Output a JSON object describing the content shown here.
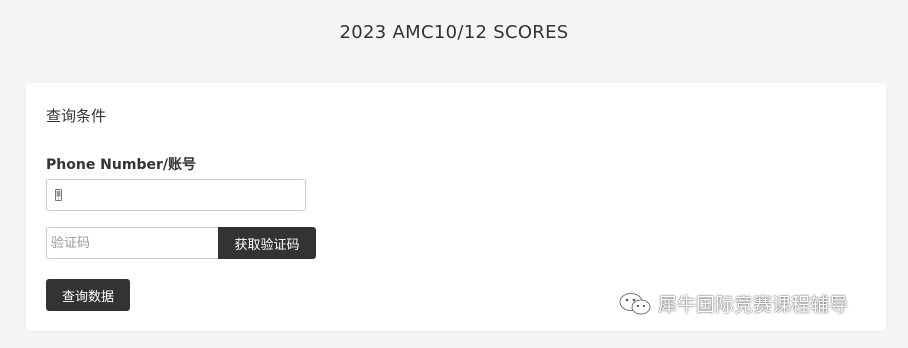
{
  "header": {
    "title": "2023 AMC10/12 SCORES"
  },
  "form": {
    "title": "查询条件",
    "phone_label": "Phone Number/账号",
    "phone_value": "",
    "code_placeholder": "验证码",
    "code_value": "",
    "get_code_label": "获取验证码",
    "submit_label": "查询数据"
  },
  "watermark": {
    "text": "犀牛国际竞赛课程辅导",
    "icon": "wechat-icon"
  },
  "colors": {
    "page_bg": "#f4f5f7",
    "card_bg": "#ffffff",
    "button_bg": "#333333",
    "button_text": "#ffffff"
  }
}
